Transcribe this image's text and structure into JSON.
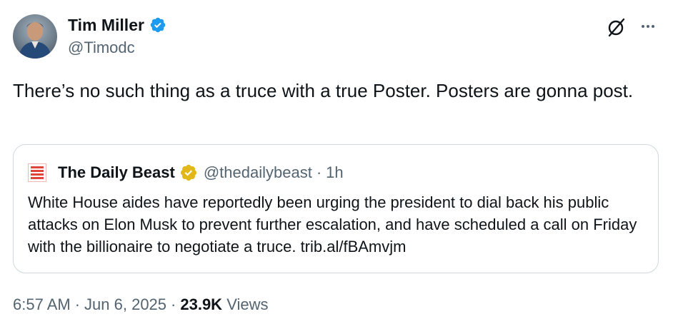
{
  "author": {
    "name": "Tim Miller",
    "handle": "@Timodc",
    "verified_color": "#1d9bf0"
  },
  "tweet": {
    "text": "There’s no such thing as a truce with a true Poster. Posters are gonna post."
  },
  "quoted": {
    "logo_icon": "daily-beast-logo",
    "name": "The Daily Beast",
    "badge_color": "#e2b719",
    "handle": "@thedailybeast",
    "separator": "·",
    "time": "1h",
    "text": "White House aides have reportedly been urging the president to dial back his public attacks on Elon Musk to prevent further escalation, and have scheduled a call on Friday with the billionaire to negotiate a truce. trib.al/fBAmvjm"
  },
  "meta": {
    "time": "6:57 AM",
    "separator": "·",
    "date": "Jun 6, 2025",
    "views_count": "23.9K",
    "views_label": "Views"
  },
  "icons": {
    "grok": "grok-icon",
    "more": "more-icon"
  }
}
